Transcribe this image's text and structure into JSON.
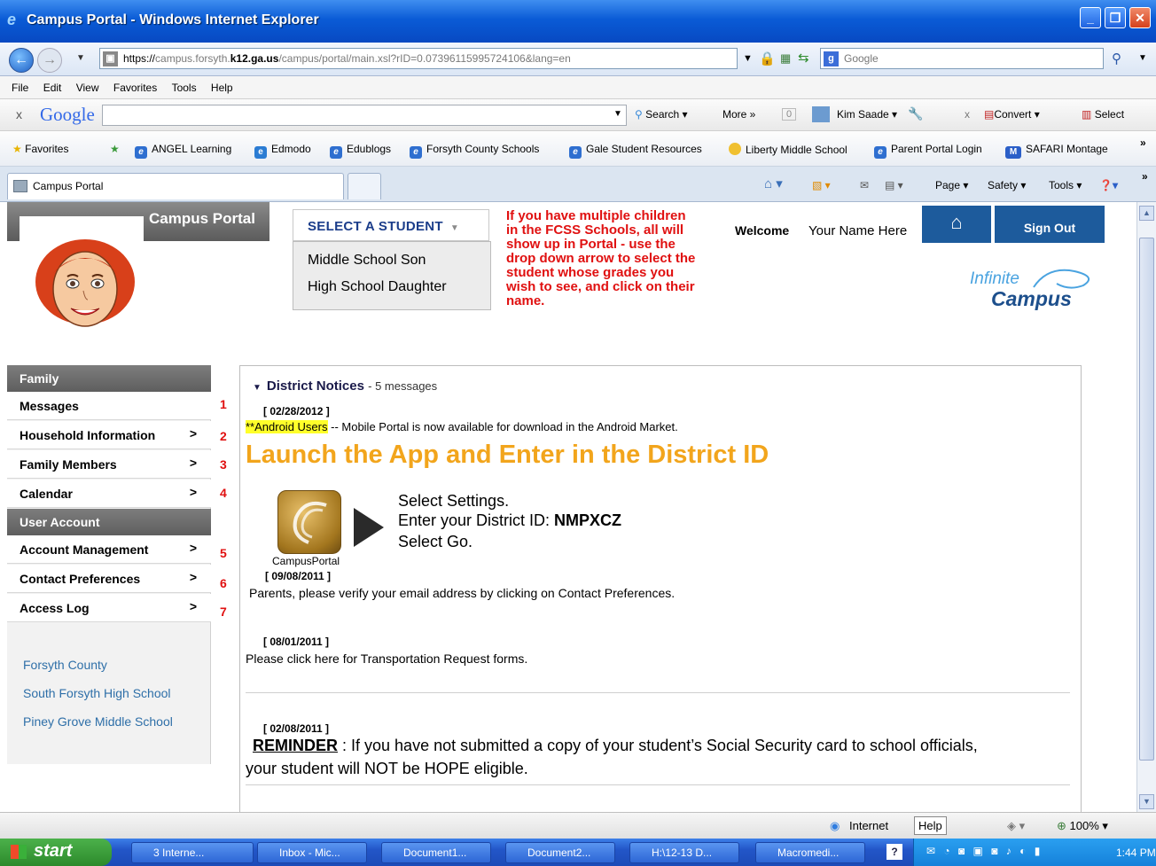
{
  "window": {
    "title": "Campus Portal - Windows Internet Explorer"
  },
  "address": {
    "url_prefix": "https://",
    "url_dim1": "campus.forsyth.",
    "url_bold": "k12.ga.us",
    "url_dim2": "/campus/portal/main.xsl?rID=0.07396115995724106&lang=en",
    "search_placeholder": "Google"
  },
  "menu": [
    "File",
    "Edit",
    "View",
    "Favorites",
    "Tools",
    "Help"
  ],
  "google_toolbar": {
    "logo": "Google",
    "search_label": "Search",
    "more_label": "More »",
    "count": "0",
    "user": "Kim Saade",
    "convert_label": "Convert",
    "select_label": "Select"
  },
  "favorites": {
    "label": "Favorites",
    "items": [
      "ANGEL Learning",
      "Edmodo",
      "Edublogs",
      "Forsyth County Schools",
      "Gale Student Resources",
      "Liberty Middle School",
      "Parent Portal Login",
      "SAFARI Montage"
    ]
  },
  "tabs": {
    "active": "Campus Portal",
    "tools": {
      "page": "Page",
      "safety": "Safety",
      "tools": "Tools"
    }
  },
  "portal": {
    "header_label": "Campus Portal",
    "select_student": "SELECT A STUDENT",
    "students": [
      "Middle School Son",
      "High School Daughter"
    ],
    "info_lines": [
      "If you have multiple children",
      "in the FCSS Schools, all will",
      "show up in Portal - use the",
      "drop down arrow to select the",
      "student whose grades you",
      "wish to see, and click on their",
      "name."
    ],
    "welcome": "Welcome",
    "user_name": "Your Name Here",
    "sign_out": "Sign Out",
    "logo_line1": "Infinite",
    "logo_line2": "Campus"
  },
  "sidebar": {
    "family_header": "Family",
    "family_items": [
      {
        "label": "Messages",
        "num": "1"
      },
      {
        "label": "Household Information",
        "num": "2"
      },
      {
        "label": "Family Members",
        "num": "3"
      },
      {
        "label": "Calendar",
        "num": "4"
      }
    ],
    "account_header": "User Account",
    "account_items": [
      {
        "label": "Account Management",
        "num": "5"
      },
      {
        "label": "Contact Preferences",
        "num": "6"
      },
      {
        "label": "Access Log",
        "num": "7"
      }
    ],
    "links": [
      "Forsyth County",
      "South Forsyth High School",
      "Piney Grove Middle School"
    ]
  },
  "notices": {
    "title": "District Notices",
    "count": "- 5 messages",
    "n1_date": "[ 02/28/2012 ]",
    "n1_highlight": "**Android Users",
    "n1_text": " -- Mobile Portal is now available for download in the  Android Market.",
    "launch": "Launch the App and Enter in the District ID",
    "step1": "Select Settings.",
    "step2_label": "Enter your District ID:  ",
    "step2_id": "NMPXCZ",
    "step3": "Select Go.",
    "app_caption": "CampusPortal",
    "n2_date": "[ 09/08/2011 ]",
    "n2_text": "Parents, please verify your email address by clicking on Contact Preferences.",
    "n3_date": "[ 08/01/2011 ]",
    "n3_text": "Please  click here for Transportation Request forms.",
    "n4_date": "[ 02/08/2011 ]",
    "n4_reminder": "REMINDER",
    "n4_text1": " :  If you have not submitted a copy of your student’s Social Security card to school officials,",
    "n4_text2": "your student will NOT be HOPE eligible."
  },
  "status": {
    "zone": "Internet",
    "help": "Help",
    "zoom": "100%"
  },
  "taskbar": {
    "start": "start",
    "tasks": [
      "3 Interne...",
      "Inbox - Mic...",
      "Document1...",
      "Document2...",
      "H:\\12-13 D...",
      "Macromedi..."
    ],
    "clock": "1:44 PM"
  }
}
